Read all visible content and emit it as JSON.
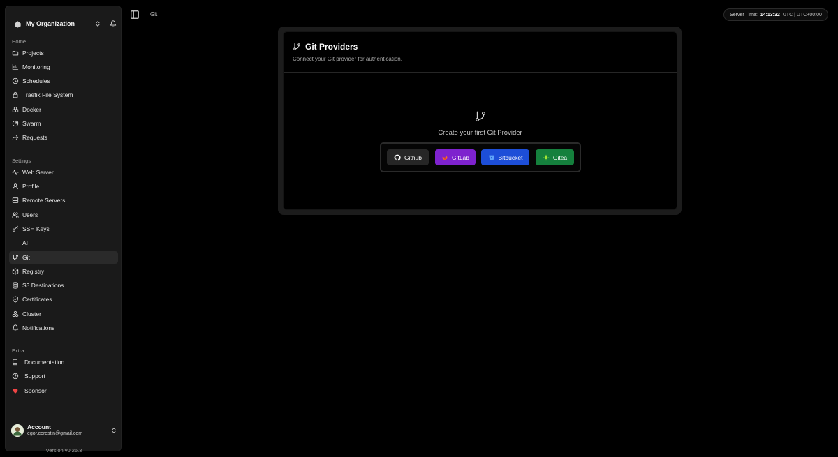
{
  "organization": {
    "name": "My Organization"
  },
  "sidebar": {
    "home_label": "Home",
    "home_items": [
      {
        "label": "Projects",
        "icon": "folder-icon"
      },
      {
        "label": "Monitoring",
        "icon": "chart-icon"
      },
      {
        "label": "Schedules",
        "icon": "clock-icon"
      },
      {
        "label": "Traefik File System",
        "icon": "file-lock-icon"
      },
      {
        "label": "Docker",
        "icon": "boxes-icon"
      },
      {
        "label": "Swarm",
        "icon": "pie-icon"
      },
      {
        "label": "Requests",
        "icon": "forward-icon"
      }
    ],
    "settings_label": "Settings",
    "settings_items": [
      {
        "label": "Web Server",
        "icon": "activity-icon"
      },
      {
        "label": "Profile",
        "icon": "user-icon"
      },
      {
        "label": "Remote Servers",
        "icon": "server-icon"
      },
      {
        "label": "Users",
        "icon": "users-icon"
      },
      {
        "label": "SSH Keys",
        "icon": "key-icon"
      },
      {
        "label": "AI",
        "icon": "sparkle-icon"
      },
      {
        "label": "Git",
        "icon": "git-branch-icon",
        "active": true
      },
      {
        "label": "Registry",
        "icon": "package-icon"
      },
      {
        "label": "S3 Destinations",
        "icon": "database-icon"
      },
      {
        "label": "Certificates",
        "icon": "shield-icon"
      },
      {
        "label": "Cluster",
        "icon": "boxes-icon"
      },
      {
        "label": "Notifications",
        "icon": "bell-icon"
      }
    ],
    "extra_label": "Extra",
    "extra_items": [
      {
        "label": "Documentation",
        "icon": "book-icon"
      },
      {
        "label": "Support",
        "icon": "help-circle-icon"
      },
      {
        "label": "Sponsor",
        "icon": "heart-icon"
      }
    ]
  },
  "account": {
    "name": "Account",
    "email": "egor.corostin@gmail.com",
    "version": "Version v0.26.3"
  },
  "header": {
    "breadcrumb": "Git",
    "server_time_label": "Server Time:",
    "server_time": "14:13:32",
    "timezone": "UTC | UTC+00:00"
  },
  "card": {
    "title": "Git Providers",
    "description": "Connect your Git provider for authentication.",
    "empty_text": "Create your first Git Provider",
    "providers": [
      {
        "label": "Github",
        "color": "#262626"
      },
      {
        "label": "GitLab",
        "color": "#7e22ce"
      },
      {
        "label": "Bitbucket",
        "color": "#1d4ed8"
      },
      {
        "label": "Gitea",
        "color": "#15803d"
      }
    ]
  }
}
